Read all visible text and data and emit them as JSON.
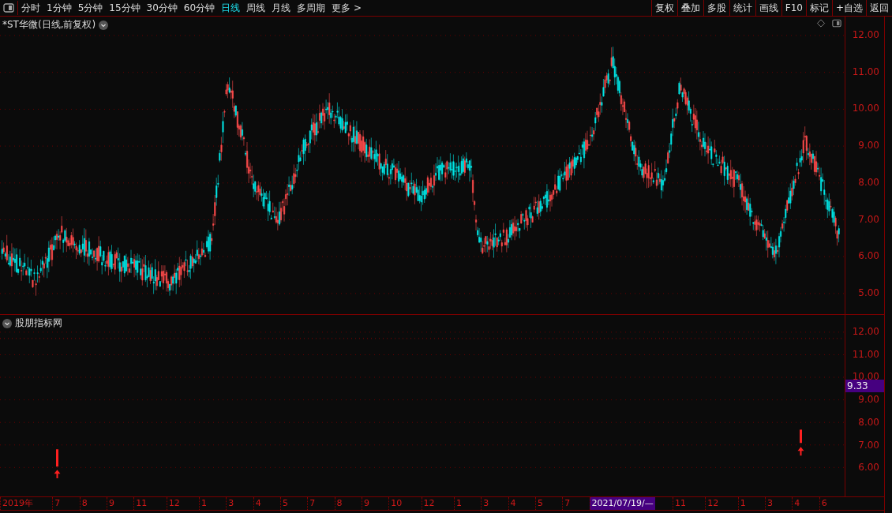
{
  "toolbar": {
    "periods": [
      {
        "label": "分时",
        "selected": false
      },
      {
        "label": "1分钟",
        "selected": false
      },
      {
        "label": "5分钟",
        "selected": false
      },
      {
        "label": "15分钟",
        "selected": false
      },
      {
        "label": "30分钟",
        "selected": false
      },
      {
        "label": "60分钟",
        "selected": false
      },
      {
        "label": "日线",
        "selected": true
      },
      {
        "label": "周线",
        "selected": false
      },
      {
        "label": "月线",
        "selected": false
      },
      {
        "label": "多周期",
        "selected": false
      },
      {
        "label": "更多 >",
        "selected": false
      }
    ],
    "buttons": [
      "复权",
      "叠加",
      "多股",
      "统计",
      "画线",
      "F10",
      "标记",
      "+自选",
      "返回"
    ]
  },
  "main_chart": {
    "title": "*ST华微(日线,前复权)",
    "y_axis": [
      "12.00",
      "11.00",
      "10.00",
      "9.00",
      "8.00",
      "7.00",
      "6.00",
      "5.00"
    ]
  },
  "indicator": {
    "title": "股朋指标网",
    "y_axis": [
      "12.00",
      "11.00",
      "10.00",
      "9.00",
      "8.00",
      "7.00",
      "6.00"
    ],
    "cursor_value": "9.33"
  },
  "time_axis": [
    {
      "text": "2019年",
      "highlighted": false
    },
    {
      "text": "7",
      "highlighted": false
    },
    {
      "text": "8",
      "highlighted": false
    },
    {
      "text": "9",
      "highlighted": false
    },
    {
      "text": "11",
      "highlighted": false
    },
    {
      "text": "12",
      "highlighted": false
    },
    {
      "text": "1",
      "highlighted": false
    },
    {
      "text": "3",
      "highlighted": false
    },
    {
      "text": "4",
      "highlighted": false
    },
    {
      "text": "5",
      "highlighted": false
    },
    {
      "text": "7",
      "highlighted": false
    },
    {
      "text": "8",
      "highlighted": false
    },
    {
      "text": "9",
      "highlighted": false
    },
    {
      "text": "10",
      "highlighted": false
    },
    {
      "text": "12",
      "highlighted": false
    },
    {
      "text": "1",
      "highlighted": false
    },
    {
      "text": "3",
      "highlighted": false
    },
    {
      "text": "4",
      "highlighted": false
    },
    {
      "text": "5",
      "highlighted": false
    },
    {
      "text": "7",
      "highlighted": false
    },
    {
      "text": "2021/07/19/—",
      "highlighted": true
    },
    {
      "text": "11",
      "highlighted": false
    },
    {
      "text": "12",
      "highlighted": false
    },
    {
      "text": "1",
      "highlighted": false
    },
    {
      "text": "3",
      "highlighted": false
    },
    {
      "text": "4",
      "highlighted": false
    },
    {
      "text": "6",
      "highlighted": false
    }
  ]
}
